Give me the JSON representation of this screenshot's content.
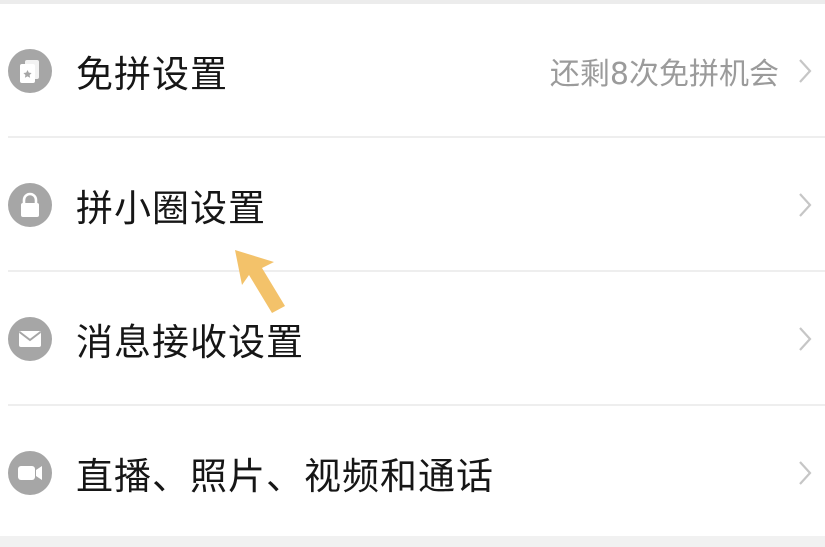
{
  "settings": {
    "items": [
      {
        "label": "免拼设置",
        "hint": "还剩8次免拼机会",
        "icon": "card-star-icon"
      },
      {
        "label": "拼小圈设置",
        "hint": "",
        "icon": "lock-icon"
      },
      {
        "label": "消息接收设置",
        "hint": "",
        "icon": "envelope-icon"
      },
      {
        "label": "直播、照片、视频和通话",
        "hint": "",
        "icon": "video-camera-icon"
      }
    ]
  },
  "annotation": {
    "type": "pointer-arrow",
    "color": "#f3c26a",
    "points_to": "拼小圈设置"
  },
  "colors": {
    "icon_bg": "#a6a6a6",
    "text": "#161616",
    "hint": "#9b9b9b",
    "divider": "#eeeeee"
  }
}
